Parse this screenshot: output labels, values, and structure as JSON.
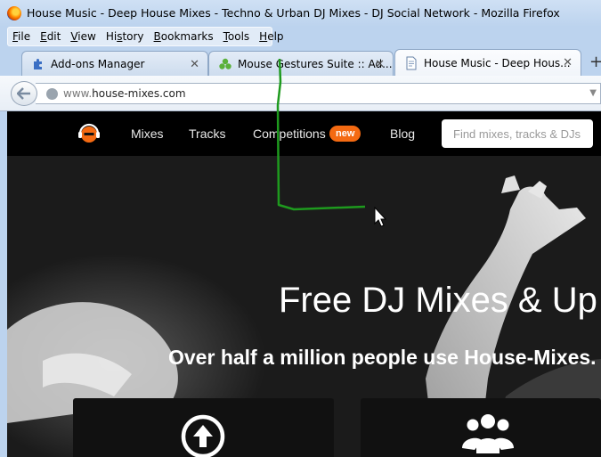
{
  "window": {
    "title": "House Music - Deep House Mixes - Techno & Urban DJ Mixes - DJ Social Network - Mozilla Firefox"
  },
  "menu": [
    {
      "ul": "F",
      "rest": "ile"
    },
    {
      "ul": "E",
      "rest": "dit"
    },
    {
      "ul": "V",
      "rest": "iew"
    },
    {
      "ul": "",
      "pre": "Hi",
      "ul2": "s",
      "rest": "tory"
    },
    {
      "ul": "B",
      "rest": "ookmarks"
    },
    {
      "ul": "T",
      "rest": "ools"
    },
    {
      "ul": "H",
      "rest": "elp"
    }
  ],
  "tabs": [
    {
      "label": "Add-ons Manager",
      "icon": "puzzle-icon",
      "active": false
    },
    {
      "label": "Mouse Gestures Suite :: Ad...",
      "icon": "gesture-addon-icon",
      "active": false
    },
    {
      "label": "House Music - Deep Hous...",
      "icon": "page-icon",
      "active": true
    }
  ],
  "navbar": {
    "url_prefix": "www.",
    "url_domain": "house-mixes.com"
  },
  "site": {
    "nav": {
      "mixes": "Mixes",
      "tracks": "Tracks",
      "competitions": "Competitions",
      "new_badge": "new",
      "blog": "Blog",
      "search_placeholder": "Find mixes, tracks & DJs"
    },
    "hero": {
      "title": "Free DJ Mixes & Up",
      "subtitle": "Over half a million people use House-Mixes."
    }
  },
  "colors": {
    "accent": "#f46a12",
    "gesture_trail": "#1e9a1e"
  }
}
